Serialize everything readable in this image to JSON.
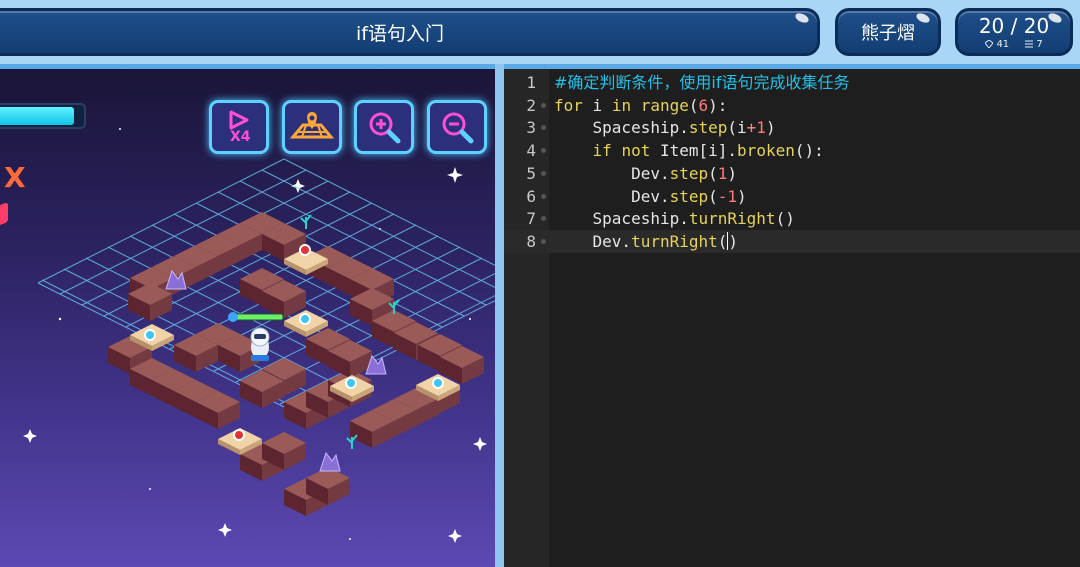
{
  "header": {
    "title": "if语句入门",
    "user": "熊子熠",
    "score": "20 / 20",
    "stat1": "41",
    "stat2": "7"
  },
  "toolbar": {
    "speed_label": "X4"
  },
  "game": {
    "side_marker": "X",
    "energy_level": 0.83
  },
  "editor": {
    "lines": [
      {
        "n": "1",
        "parts": [
          [
            "cm",
            "#确定判断条件，使用if语句完成收集任务"
          ]
        ]
      },
      {
        "n": "2",
        "parts": [
          [
            "kw",
            "for"
          ],
          [
            "t",
            " i "
          ],
          [
            "kw",
            "in"
          ],
          [
            "t",
            " "
          ],
          [
            "fn",
            "range"
          ],
          [
            "t",
            "("
          ],
          [
            "num",
            "6"
          ],
          [
            "t",
            "):"
          ]
        ]
      },
      {
        "n": "3",
        "parts": [
          [
            "t",
            "    Spaceship."
          ],
          [
            "fn",
            "step"
          ],
          [
            "t",
            "(i"
          ],
          [
            "op",
            "+"
          ],
          [
            "num",
            "1"
          ],
          [
            "t",
            ")"
          ]
        ]
      },
      {
        "n": "4",
        "parts": [
          [
            "t",
            "    "
          ],
          [
            "kw",
            "if"
          ],
          [
            "t",
            " "
          ],
          [
            "kw",
            "not"
          ],
          [
            "t",
            " Item[i]."
          ],
          [
            "fn",
            "broken"
          ],
          [
            "t",
            "():"
          ]
        ]
      },
      {
        "n": "5",
        "parts": [
          [
            "t",
            "        Dev."
          ],
          [
            "fn",
            "step"
          ],
          [
            "t",
            "("
          ],
          [
            "num",
            "1"
          ],
          [
            "t",
            ")"
          ]
        ]
      },
      {
        "n": "6",
        "parts": [
          [
            "t",
            "        Dev."
          ],
          [
            "fn",
            "step"
          ],
          [
            "t",
            "("
          ],
          [
            "num",
            "-1"
          ],
          [
            "t",
            ")"
          ]
        ]
      },
      {
        "n": "7",
        "parts": [
          [
            "t",
            "    Spaceship."
          ],
          [
            "fn",
            "turnRight"
          ],
          [
            "t",
            "()"
          ]
        ]
      },
      {
        "n": "8",
        "parts": [
          [
            "t",
            "    Dev."
          ],
          [
            "fn",
            "turnRight"
          ],
          [
            "t",
            "()"
          ]
        ]
      }
    ],
    "active_line": 8
  }
}
